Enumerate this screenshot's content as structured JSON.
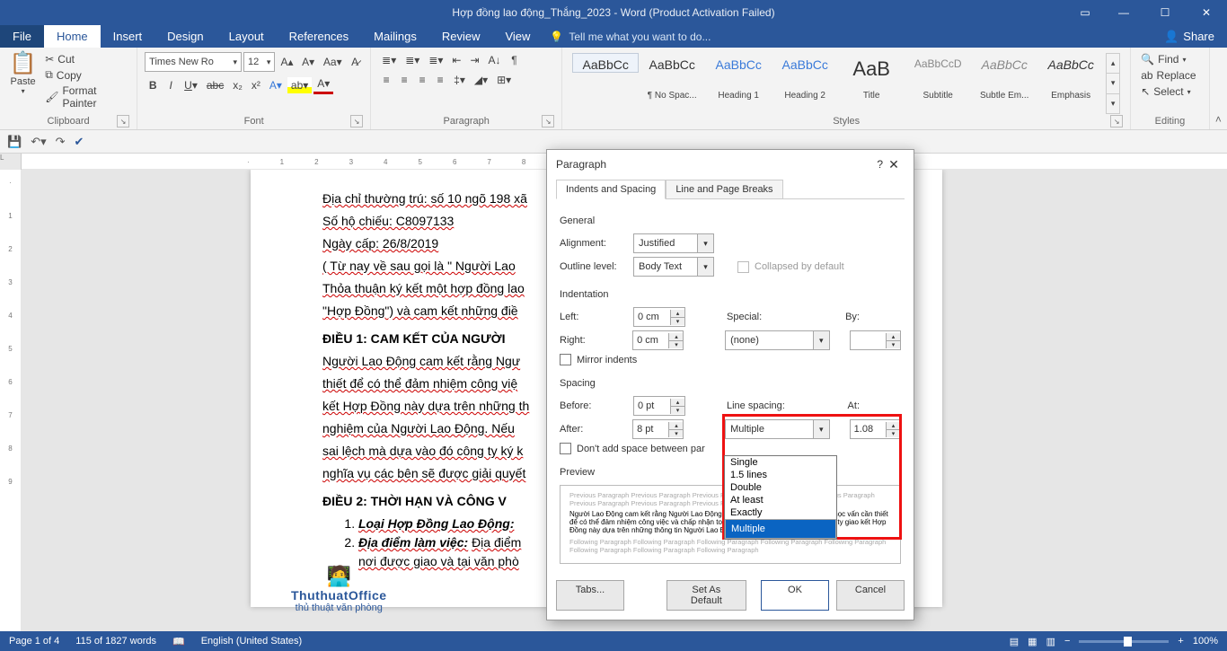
{
  "titlebar": {
    "title": "Hợp đồng lao động_Thắng_2023 - Word (Product Activation Failed)"
  },
  "share": "Share",
  "menu": {
    "file": "File",
    "home": "Home",
    "insert": "Insert",
    "design": "Design",
    "layout": "Layout",
    "references": "References",
    "mailings": "Mailings",
    "review": "Review",
    "view": "View",
    "tell": "Tell me what you want to do..."
  },
  "clipboard": {
    "paste": "Paste",
    "cut": "Cut",
    "copy": "Copy",
    "painter": "Format Painter",
    "label": "Clipboard"
  },
  "font": {
    "name": "Times New Ro",
    "size": "12",
    "label": "Font"
  },
  "paragraph": {
    "label": "Paragraph"
  },
  "styles": {
    "label": "Styles",
    "items": [
      {
        "preview": "AaBbCc",
        "name": "¶ Normal"
      },
      {
        "preview": "AaBbCc",
        "name": "¶ No Spac..."
      },
      {
        "preview": "AaBbCc",
        "name": "Heading 1"
      },
      {
        "preview": "AaBbCc",
        "name": "Heading 2"
      },
      {
        "preview": "AaB",
        "name": "Title"
      },
      {
        "preview": "AaBbCcD",
        "name": "Subtitle"
      },
      {
        "preview": "AaBbCc",
        "name": "Subtle Em..."
      },
      {
        "preview": "AaBbCc",
        "name": "Emphasis"
      }
    ]
  },
  "editing": {
    "find": "Find",
    "replace": "Replace",
    "select": "Select",
    "label": "Editing"
  },
  "doc": {
    "l1": "Địa chỉ thường trú: số 10 ngõ 198 xã",
    "l2": "Số hộ chiếu: C8097133",
    "l3": "Ngày cấp: 26/8/2019",
    "l4": " ( Từ nay về sau gọi là \" Người Lao",
    "l5": "Thỏa thuận ký kết một hợp đồng lao",
    "l6": "\"Hợp Đồng\") và cam kết những điề",
    "h1": "ĐIỀU 1: CAM KẾT CỦA NGƯỜI",
    "l7": "Người Lao Động cam kết rằng Ngư",
    "l8": "thiết để có thể đảm nhiệm công việ",
    "l9": "kết Hợp Đồng này dựa trên những th",
    "l10": "nghiệm của Người Lao Động. Nếu",
    "l11": "sai lệch mà dựa vào đó công ty ký k",
    "l12": "nghĩa vụ các bên sẽ được giải quyết",
    "h2": "ĐIỀU 2: THỜI HẠN VÀ CÔNG V",
    "li1": "Loại Hợp Đồng Lao Động:",
    "li2": "Địa điểm làm việc:",
    "li2b": "Địa điểm",
    "li3": "nơi được giao và tại văn phò"
  },
  "watermark": {
    "name": "ThuthuatOffice",
    "sub": "thủ thuật văn phòng"
  },
  "status": {
    "page": "Page 1 of 4",
    "words": "115 of 1827 words",
    "lang": "English (United States)",
    "zoom": "100%"
  },
  "dialog": {
    "title": "Paragraph",
    "tab1": "Indents and Spacing",
    "tab2": "Line and Page Breaks",
    "general": "General",
    "alignment_l": "Alignment:",
    "alignment_v": "Justified",
    "outline_l": "Outline level:",
    "outline_v": "Body Text",
    "collapsed": "Collapsed by default",
    "indent": "Indentation",
    "left_l": "Left:",
    "left_v": "0 cm",
    "right_l": "Right:",
    "right_v": "0 cm",
    "special_l": "Special:",
    "special_v": "(none)",
    "by_l": "By:",
    "mirror": "Mirror indents",
    "spacing": "Spacing",
    "before_l": "Before:",
    "before_v": "0 pt",
    "after_l": "After:",
    "after_v": "8 pt",
    "line_l": "Line spacing:",
    "line_v": "Multiple",
    "at_l": "At:",
    "at_v": "1.08",
    "dontadd": "Don't add space between par",
    "preview": "Preview",
    "previewGrey": "Previous Paragraph Previous Paragraph Previous Paragraph Previous Paragraph Previous Paragraph Previous Paragraph Previous Paragraph Previous Paragraph",
    "previewBlk": "Người Lao Động cam kết rằng Người Lao Động có đầy đủ kinh nghiệm và trình độ học vấn cần thiết để có thể đảm nhiệm công việc và chấp nhận toàn bộ trách nhiệm được giao. Công ty giao kết Hợp Đồng này dựa trên những thông tin Người Lao Động cung cấp về trìn",
    "previewGrey2": "Following Paragraph Following Paragraph Following Paragraph Following Paragraph Following Paragraph Following Paragraph Following Paragraph Following Paragraph",
    "tabs": "Tabs...",
    "default": "Set As Default",
    "ok": "OK",
    "cancel": "Cancel"
  },
  "dropdown": {
    "o1": "Single",
    "o2": "1.5 lines",
    "o3": "Double",
    "o4": "At least",
    "o5": "Exactly",
    "o6": "Multiple"
  }
}
